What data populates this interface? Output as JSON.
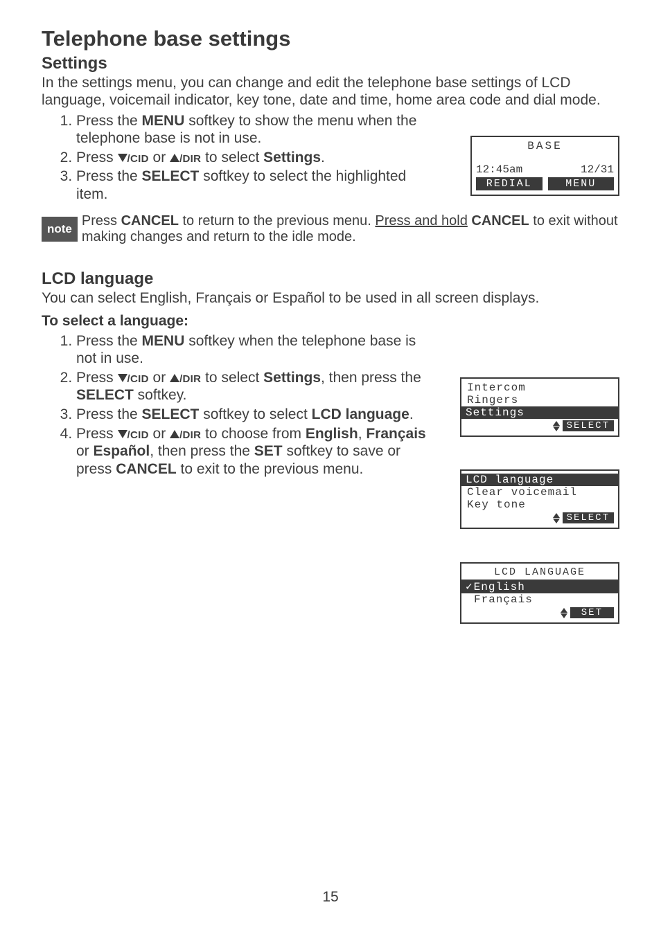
{
  "page_number": "15",
  "title": "Telephone base settings",
  "section1": {
    "heading": "Settings",
    "intro": "In the settings menu, you can change and edit the telephone base settings of LCD language, voicemail indicator, key tone, date and time, home area code and dial mode.",
    "step1_a": "Press the ",
    "step1_b": "MENU",
    "step1_c": " softkey to show the menu when the telephone base is not in use.",
    "step2_a": "Press ",
    "step2_cid": "/CID",
    "step2_mid": " or ",
    "step2_dir": "/DIR",
    "step2_b": " to select ",
    "step2_target": "Settings",
    "step2_end": ".",
    "step3_a": "Press the ",
    "step3_b": "SELECT",
    "step3_c": " softkey to select the highlighted item."
  },
  "note": {
    "label": "note",
    "a": "Press ",
    "cancel": "CANCEL",
    "b": " to return to the previous menu. ",
    "c_underlined": "Press and hold",
    "d": " ",
    "e": " to exit without making changes and return to the idle mode."
  },
  "section2": {
    "heading": "LCD language",
    "intro": "You can select English, Français or Español to be used in all screen displays.",
    "subhead": "To select a language:",
    "s1a": "Press the ",
    "s1b": "MENU",
    "s1c": " softkey when the telephone base is not in use.",
    "s2a": "Press ",
    "s2b": " to select ",
    "s2t": "Settings",
    "s2c": ", then press the ",
    "s2d": "SELECT",
    "s2e": " softkey.",
    "s3a": "Press the ",
    "s3b": "SELECT",
    "s3c": " softkey to select ",
    "s3t": "LCD language",
    "s3e": ".",
    "s4a": "Press ",
    "s4b": " to choose from ",
    "s4e": "English",
    "s4f": ", ",
    "s4g": "Français",
    "s4h": " or ",
    "s4i": "Español",
    "s4j": ", then press the ",
    "s4k": "SET",
    "s4l": " softkey to save or press ",
    "s4m": "CANCEL",
    "s4n": " to exit to the previous menu."
  },
  "lcd_idle": {
    "title": "BASE",
    "time": "12:45am",
    "date": "12/31",
    "left": "REDIAL",
    "right": "MENU"
  },
  "lcd_menu1": {
    "i1": "Intercom",
    "i2": "Ringers",
    "i3": "Settings",
    "btn": "SELECT"
  },
  "lcd_menu2": {
    "i1": "LCD language",
    "i2": "Clear voicemail",
    "i3": "Key tone",
    "btn": "SELECT"
  },
  "lcd_menu3": {
    "title": "LCD LANGUAGE",
    "i1": "English",
    "i2": "Français",
    "btn": "SET"
  }
}
